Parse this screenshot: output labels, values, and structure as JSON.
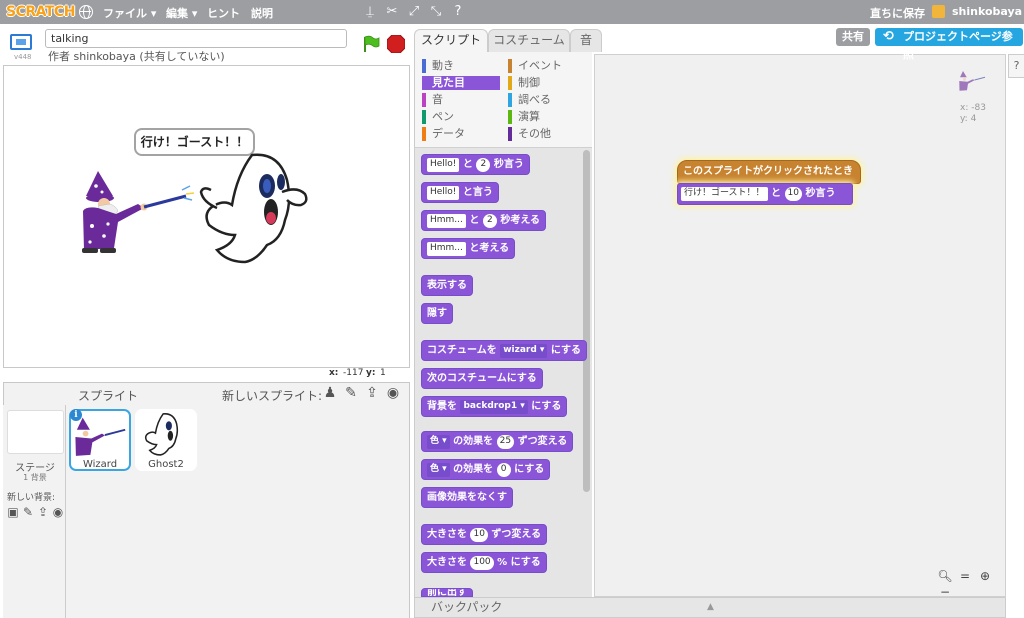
{
  "topbar": {
    "logo": "SCRATCH",
    "menus": [
      "ファイル ▾",
      "編集 ▾",
      "ヒント",
      "説明"
    ],
    "save_now": "直ちに保存",
    "username": "shinkobaya"
  },
  "stage": {
    "project_title": "talking",
    "author": "作者 shinkobaya (共有していない)",
    "version": "v448",
    "speech": "行け！ゴースト！！",
    "coords": {
      "x_label": "x:",
      "x_value": "-117",
      "y_label": "y:",
      "y_value": "1"
    }
  },
  "sprites": {
    "title": "スプライト",
    "new_sprite_label": "新しいスプライト:",
    "stage_label": "ステージ",
    "stage_count": "1 背景",
    "new_backdrop_label": "新しい背景:",
    "items": [
      {
        "name": "Wizard"
      },
      {
        "name": "Ghost2"
      }
    ]
  },
  "tabs": {
    "scripts": "スクリプト",
    "costumes": "コスチューム",
    "sounds": "音"
  },
  "categories": [
    {
      "label": "動き",
      "color": "#4a6cd4"
    },
    {
      "label": "イベント",
      "color": "#c88330"
    },
    {
      "label": "見た目",
      "color": "#8a55d7"
    },
    {
      "label": "制御",
      "color": "#e1a91a"
    },
    {
      "label": "音",
      "color": "#bb42c3"
    },
    {
      "label": "調べる",
      "color": "#2ca5e2"
    },
    {
      "label": "ペン",
      "color": "#0e9a6c"
    },
    {
      "label": "演算",
      "color": "#5cb712"
    },
    {
      "label": "データ",
      "color": "#ee7d16"
    },
    {
      "label": "その他",
      "color": "#632d99"
    }
  ],
  "blocks": {
    "b1": {
      "t1": "Hello!",
      "t2": "と",
      "n": "2",
      "t3": "秒言う"
    },
    "b2": {
      "t1": "Hello!",
      "t2": "と言う"
    },
    "b3": {
      "t1": "Hmm...",
      "t2": "と",
      "n": "2",
      "t3": "秒考える"
    },
    "b4": {
      "t1": "Hmm...",
      "t2": "と考える"
    },
    "b5": "表示する",
    "b6": "隠す",
    "b7": {
      "t1": "コスチュームを",
      "dd": "wizard",
      "t2": "にする"
    },
    "b8": "次のコスチュームにする",
    "b9": {
      "t1": "背景を",
      "dd": "backdrop1",
      "t2": "にする"
    },
    "b10": {
      "t1": "色",
      "t2": "の効果を",
      "n": "25",
      "t3": "ずつ変える"
    },
    "b11": {
      "t1": "色",
      "t2": "の効果を",
      "n": "0",
      "t3": "にする"
    },
    "b12": "画像効果をなくす",
    "b13": {
      "t1": "大きさを",
      "n": "10",
      "t2": "ずつ変える"
    },
    "b14": {
      "t1": "大きさを",
      "n": "100",
      "t2": "% にする"
    },
    "b15": "前に出す"
  },
  "script": {
    "hat": "このスプライトがクリックされたとき",
    "say": {
      "text": "行け！ゴースト！！",
      "t2": "と",
      "n": "10",
      "t3": "秒言う"
    }
  },
  "sprite_info": {
    "x": "x: -83",
    "y": "y: 4"
  },
  "buttons": {
    "share": "共有",
    "project_page": "プロジェクトページ参照"
  },
  "backpack": "バックパック"
}
